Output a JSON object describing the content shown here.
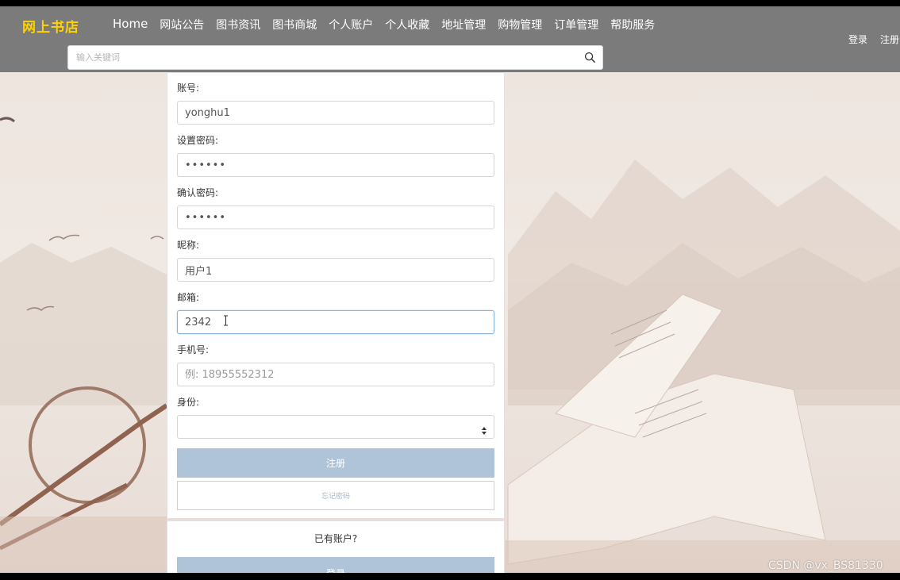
{
  "header": {
    "brand": "网上书店",
    "nav": [
      "Home",
      "网站公告",
      "图书资讯",
      "图书商城",
      "个人账户",
      "个人收藏",
      "地址管理",
      "购物管理",
      "订单管理",
      "帮助服务"
    ],
    "login_label": "登录",
    "register_label": "注册"
  },
  "search": {
    "placeholder": "输入关键词",
    "icon": "search-icon"
  },
  "form": {
    "account": {
      "label": "账号:",
      "value": "yonghu1"
    },
    "password": {
      "label": "设置密码:",
      "value": "••••••"
    },
    "confirm_password": {
      "label": "确认密码:",
      "value": "••••••"
    },
    "nickname": {
      "label": "昵称:",
      "value": "用户1"
    },
    "email": {
      "label": "邮箱:",
      "value": "2342"
    },
    "phone": {
      "label": "手机号:",
      "placeholder": "例: 18955552312"
    },
    "role": {
      "label": "身份:",
      "value": ""
    },
    "submit_label": "注册",
    "forgot_label": "忘记密码",
    "have_account": "已有账户?",
    "login_label": "登录"
  },
  "watermark": "CSDN @vx_BS81330",
  "colors": {
    "navbar": "#7b7b7b",
    "brand": "#ffd200",
    "primary_button": "#b0c4d9"
  }
}
